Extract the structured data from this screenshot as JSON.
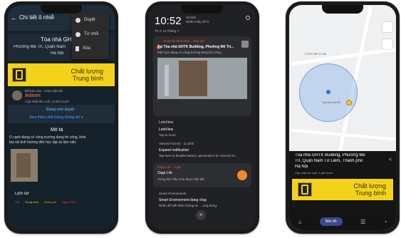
{
  "phone1": {
    "header_title": "Chi tiết ô nhiễ",
    "building": "Tòa nhà GHTK",
    "address_line1": "Phường Mễ Trì, Quận Nam",
    "address_line2": "Hà Nội",
    "menu": [
      {
        "label": "Duyệt",
        "icon": "check-circle-icon"
      },
      {
        "label": "Từ chối",
        "icon": "close-circle-icon"
      },
      {
        "label": "Xóa",
        "icon": "trash-icon"
      }
    ],
    "banner": {
      "line1": "Chất lượng",
      "line2": "Trung bình"
    },
    "reporter_small": "Đã báo cáo · cùng cấp bậc",
    "reporter_name": "Admin",
    "reporter_time": "Cập nhật lần cuối: 3 phút trước",
    "status": "Đang chờ duyệt",
    "status_action": "Xem thêm chất lượng không khí ▾",
    "desc_title": "Mô tả",
    "desc_text1": "Ô cạnh đang có công trường đang thi công, khói",
    "desc_text2": "bụi rất ảnh hưởng đến học tập và làm việc",
    "history_title": "Lịch sử",
    "history_legend": [
      "Tốt",
      "Trung bình",
      "Không tốt",
      "Nguy hiểm"
    ]
  },
  "phone2": {
    "time": "10:52",
    "carrier": "Hà Nội",
    "weather": "Nhiều mây 28°C",
    "date": "Th 4, 13 Tháng 7",
    "notifications": [
      {
        "app": "Smart Environment · Bây giờ",
        "title": "Tại Tòa nhà GHTK Building, Phường Mễ Trì...",
        "body": "Một cụm đang có công trường đang thi công..."
      },
      {
        "app": "LetsView",
        "title": "LetsView",
        "body": "Tap to more"
      },
      {
        "app": "Vanced microG · 11 phút",
        "title": "Expand notification",
        "body": "Tap here to disable battery optimization for vanced mi..."
      },
      {
        "app": "Zapp Life · 1 giờ",
        "title": "Zapp Life",
        "body": "Vừng đơn hãy chia được liên kết"
      },
      {
        "app": "Smart Environment",
        "title": "Smart Environment đang chạy",
        "body": "Nhấn để biết thêm thông tin ... ứng dụng."
      }
    ]
  },
  "phone3": {
    "map_label1": "CTGC Mễ Trì Hạ",
    "map_label2": "Tòa nhà GHTK",
    "title_line1": "Tòa nhà GHTK Building, Phường Mễ",
    "title_line2": "Trì, Quận Nam Từ Liêm, Thành phố",
    "title_line3": "Hà Nội",
    "updated": "Cập nhật lần cuối: 1 giờ trước",
    "banner": {
      "line1": "Chất lượng",
      "line2": "Trung bình"
    },
    "nav_active": "Bản đồ"
  },
  "colors": {
    "banner": "#f3d21b",
    "alert": "#e25b3c",
    "link": "#4aa3ff",
    "status": "#6cc6ff"
  }
}
